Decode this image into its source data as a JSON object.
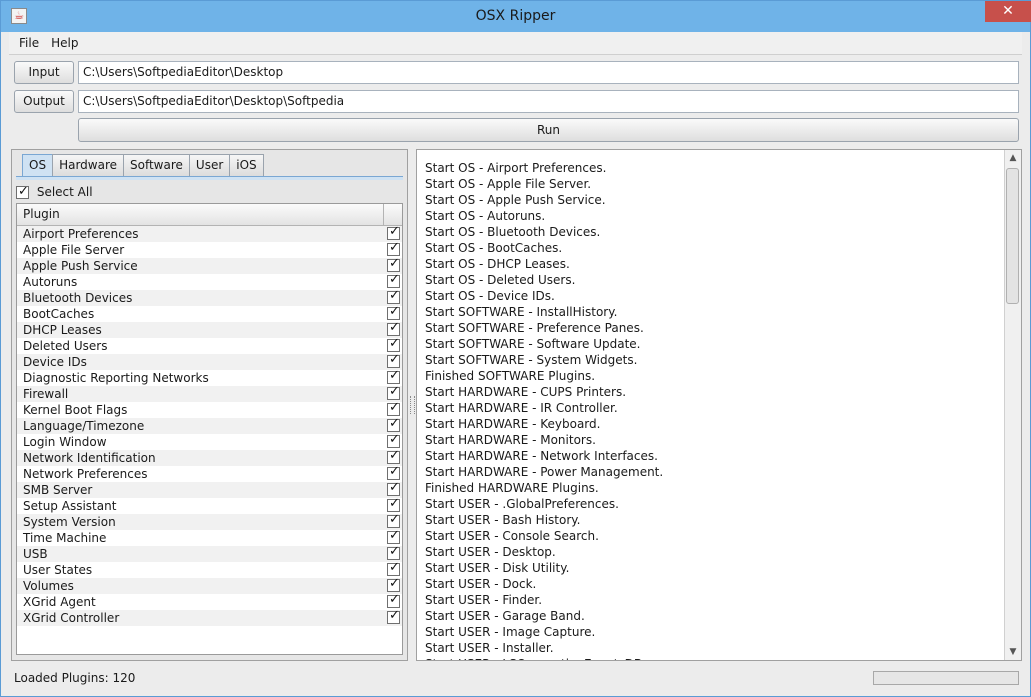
{
  "window": {
    "title": "OSX Ripper",
    "close_glyph": "✕",
    "icon": "java-cup-icon"
  },
  "menu": [
    "File",
    "Help"
  ],
  "paths": {
    "input_label": "Input",
    "input_value": "C:\\Users\\SoftpediaEditor\\Desktop",
    "output_label": "Output",
    "output_value": "C:\\Users\\SoftpediaEditor\\Desktop\\Softpedia",
    "run_label": "Run"
  },
  "tabs": [
    "OS",
    "Hardware",
    "Software",
    "User",
    "iOS"
  ],
  "active_tab": "OS",
  "plugins": {
    "select_all_label": "Select All",
    "select_all_checked": true,
    "column_header": "Plugin",
    "items": [
      {
        "name": "Airport Preferences",
        "checked": true
      },
      {
        "name": "Apple File Server",
        "checked": true
      },
      {
        "name": "Apple Push Service",
        "checked": true
      },
      {
        "name": "Autoruns",
        "checked": true
      },
      {
        "name": "Bluetooth Devices",
        "checked": true
      },
      {
        "name": "BootCaches",
        "checked": true
      },
      {
        "name": "DHCP Leases",
        "checked": true
      },
      {
        "name": "Deleted Users",
        "checked": true
      },
      {
        "name": "Device IDs",
        "checked": true
      },
      {
        "name": "Diagnostic Reporting Networks",
        "checked": true
      },
      {
        "name": "Firewall",
        "checked": true
      },
      {
        "name": "Kernel Boot Flags",
        "checked": true
      },
      {
        "name": "Language/Timezone",
        "checked": true
      },
      {
        "name": "Login Window",
        "checked": true
      },
      {
        "name": "Network Identification",
        "checked": true
      },
      {
        "name": "Network Preferences",
        "checked": true
      },
      {
        "name": "SMB Server",
        "checked": true
      },
      {
        "name": "Setup Assistant",
        "checked": true
      },
      {
        "name": "System Version",
        "checked": true
      },
      {
        "name": "Time Machine",
        "checked": true
      },
      {
        "name": "USB",
        "checked": true
      },
      {
        "name": "User States",
        "checked": true
      },
      {
        "name": "Volumes",
        "checked": true
      },
      {
        "name": "XGrid Agent",
        "checked": true
      },
      {
        "name": "XGrid Controller",
        "checked": true
      }
    ]
  },
  "log": [
    "Start OS - Airport Preferences.",
    "Start OS - Apple File Server.",
    "Start OS - Apple Push Service.",
    "Start OS - Autoruns.",
    "Start OS - Bluetooth Devices.",
    "Start OS - BootCaches.",
    "Start OS - DHCP Leases.",
    "Start OS - Deleted Users.",
    "Start OS - Device IDs.",
    "Start SOFTWARE - InstallHistory.",
    "Start SOFTWARE - Preference Panes.",
    "Start SOFTWARE - Software Update.",
    "Start SOFTWARE - System Widgets.",
    "Finished SOFTWARE Plugins.",
    "Start HARDWARE - CUPS Printers.",
    "Start HARDWARE - IR Controller.",
    "Start HARDWARE - Keyboard.",
    "Start HARDWARE - Monitors.",
    "Start HARDWARE - Network Interfaces.",
    "Start HARDWARE - Power Management.",
    "Finished HARDWARE Plugins.",
    "Start USER - .GlobalPreferences.",
    "Start USER - Bash History.",
    "Start USER - Console Search.",
    "Start USER - Desktop.",
    "Start USER - Disk Utility.",
    "Start USER - Dock.",
    "Start USER - Finder.",
    "Start USER - Garage Band.",
    "Start USER - Image Capture.",
    "Start USER - Installer.",
    "Start USER - LSQuarantineEventsDB."
  ],
  "status": {
    "text": "Loaded Plugins: 120",
    "progress_fraction": 0.0
  },
  "colors": {
    "titlebar": "#6fb3e8",
    "close": "#c7504b",
    "accent": "#cfe2f3"
  }
}
